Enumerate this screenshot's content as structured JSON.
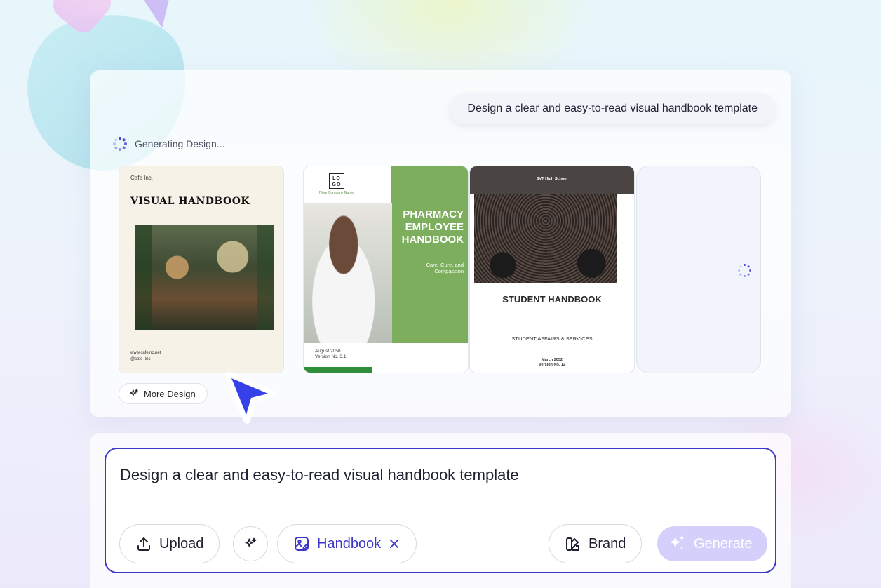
{
  "prompt": {
    "bubble_text": "Design a clear and easy-to-read visual handbook template",
    "input_value": "Design a clear and easy-to-read visual handbook template"
  },
  "status": {
    "label": "Generating Design..."
  },
  "templates": [
    {
      "company": "Cafe Inc.",
      "title": "VISUAL HANDBOOK",
      "footer_site": "www.cafeinc.net",
      "footer_handle": "@cafe_inc"
    },
    {
      "logo": "LO GO",
      "company_name": "[Your Company Name]",
      "title": "PHARMACY EMPLOYEE HANDBOOK",
      "tagline": "Care, Cure, and Compassion",
      "date": "August 2050",
      "version": "Version No. 3.1"
    },
    {
      "school": "SVT High School",
      "title": "STUDENT HANDBOOK",
      "subtitle": "STUDENT AFFAIRS & SERVICES",
      "date": "March 2052",
      "version": "Version No. 12"
    }
  ],
  "buttons": {
    "more_design": "More Design",
    "upload": "Upload",
    "handbook_tag": "Handbook",
    "brand": "Brand",
    "generate": "Generate"
  },
  "icons": {
    "more_design": "sparkle-icon",
    "upload": "upload-icon",
    "magic": "magic-sparkle-icon",
    "handbook": "image-edit-icon",
    "remove_tag": "close-icon",
    "brand": "brand-palette-icon",
    "generate": "sparkle-icon"
  },
  "colors": {
    "accent": "#3d37c9",
    "generate_disabled": "#d5d0fb",
    "pharmacy_green": "#7cae5e"
  }
}
